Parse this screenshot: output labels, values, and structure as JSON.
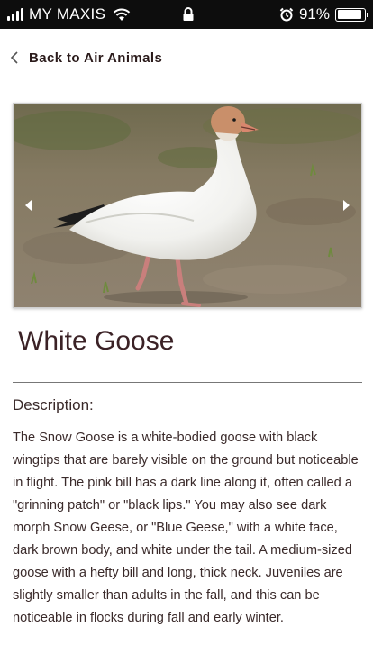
{
  "status_bar": {
    "carrier": "MY MAXIS",
    "battery_text": "91%",
    "battery_level": 0.91,
    "icons": [
      "signal-icon",
      "wifi-icon",
      "lock-icon",
      "alarm-icon",
      "battery-icon"
    ]
  },
  "nav": {
    "back_label": "Back to Air Animals"
  },
  "animal": {
    "name": "White Goose",
    "description_heading": "Description:",
    "description": "The Snow Goose is a white-bodied goose with black wingtips that are barely visible on the ground but noticeable in flight. The pink bill has a dark line along it, often called a \"grinning patch\" or \"black lips.\" You may also see dark morph Snow Geese, or \"Blue Geese,\" with a white face, dark brown body, and white under the tail. A medium-sized goose with a hefty bill and long, thick neck. Juveniles are slightly smaller than adults in the fall, and this can be noticeable in flocks during fall and early winter."
  },
  "colors": {
    "status_bar_bg": "#0d0d0d",
    "title": "#3b2226",
    "text": "#3a2a2a"
  }
}
